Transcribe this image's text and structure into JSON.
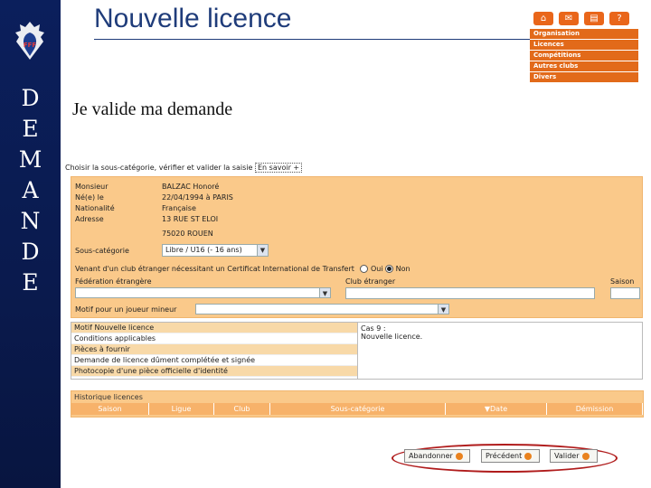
{
  "header": {
    "title": "Nouvelle licence",
    "vertical_letters": [
      "D",
      "E",
      "M",
      "A",
      "N",
      "D",
      "E"
    ],
    "logo_text": "FFF"
  },
  "nav": {
    "icons": [
      "home-icon",
      "mail-icon",
      "folder-icon",
      "help-icon"
    ],
    "items": [
      "Organisation",
      "Licences",
      "Compétitions",
      "Autres clubs",
      "Divers"
    ]
  },
  "subtitle": "Je valide ma demande",
  "instruction": {
    "text": "Choisir la sous-catégorie, vérifier et valider la saisie",
    "link": "En savoir +"
  },
  "person": {
    "civility_label": "Monsieur",
    "civility_value": "BALZAC Honoré",
    "born_label": "Né(e) le",
    "born_value": "22/04/1994 à PARIS",
    "nationality_label": "Nationalité",
    "nationality_value": "Française",
    "address_label": "Adresse",
    "address_line1": "13 RUE ST ELOI",
    "address_line2": "75020 ROUEN"
  },
  "subcategory": {
    "label": "Sous-catégorie",
    "value": "Libre / U16 (- 16 ans)"
  },
  "transfer": {
    "text": "Venant d'un club étranger nécessitant un Certificat International de Transfert",
    "yes": "Oui",
    "no": "Non",
    "selected": "Non",
    "federation_label": "Fédération étrangère",
    "club_label": "Club étranger",
    "season_label": "Saison"
  },
  "minor": {
    "label": "Motif pour un joueur mineur"
  },
  "motifs": [
    "Motif Nouvelle licence",
    "Conditions applicables",
    "Pièces à fournir",
    "Demande de licence dûment complétée et signée",
    "Photocopie d'une pièce officielle d'identité"
  ],
  "case": {
    "title": "Cas 9 :",
    "text": "Nouvelle licence."
  },
  "history": {
    "title": "Historique licences",
    "columns": [
      "Saison",
      "Ligue",
      "Club",
      "Sous-catégorie",
      "▼Date",
      "Démission"
    ]
  },
  "buttons": {
    "abandon": "Abandonner",
    "previous": "Précédent",
    "validate": "Valider"
  },
  "colors": {
    "navy": "#0b1f5c",
    "orange_panel": "#fac98a",
    "orange_nav": "#e26a1a",
    "highlight_ellipse": "#b01c1c"
  }
}
